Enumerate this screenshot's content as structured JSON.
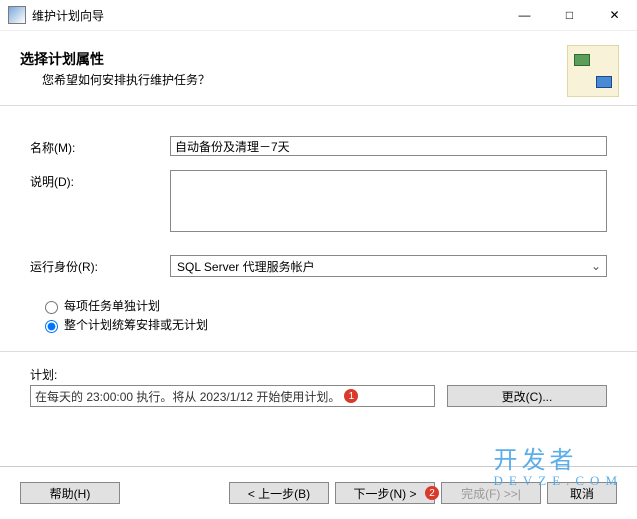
{
  "window": {
    "title": "维护计划向导",
    "min": "—",
    "max": "□",
    "close": "✕"
  },
  "header": {
    "title": "选择计划属性",
    "subtitle": "您希望如何安排执行维护任务？"
  },
  "form": {
    "name_label": "名称(M):",
    "name_value": "自动备份及清理－7天",
    "desc_label": "说明(D):",
    "desc_value": "",
    "runas_label": "运行身份(R):",
    "runas_value": "SQL Server 代理服务帐户"
  },
  "radios": {
    "opt1": "每项任务单独计划",
    "opt2": "整个计划统筹安排或无计划",
    "selected": "opt2"
  },
  "schedule": {
    "label": "计划:",
    "text": "在每天的 23:00:00 执行。将从 2023/1/12 开始使用计划。",
    "badge": "1",
    "change_btn": "更改(C)..."
  },
  "footer": {
    "help": "帮助(H)",
    "back": "< 上一步(B)",
    "next": "下一步(N) >",
    "next_badge": "2",
    "finish": "完成(F) >>|",
    "cancel": "取消"
  },
  "watermark": {
    "main": "开发者",
    "sub": "DEVZE.COM"
  }
}
